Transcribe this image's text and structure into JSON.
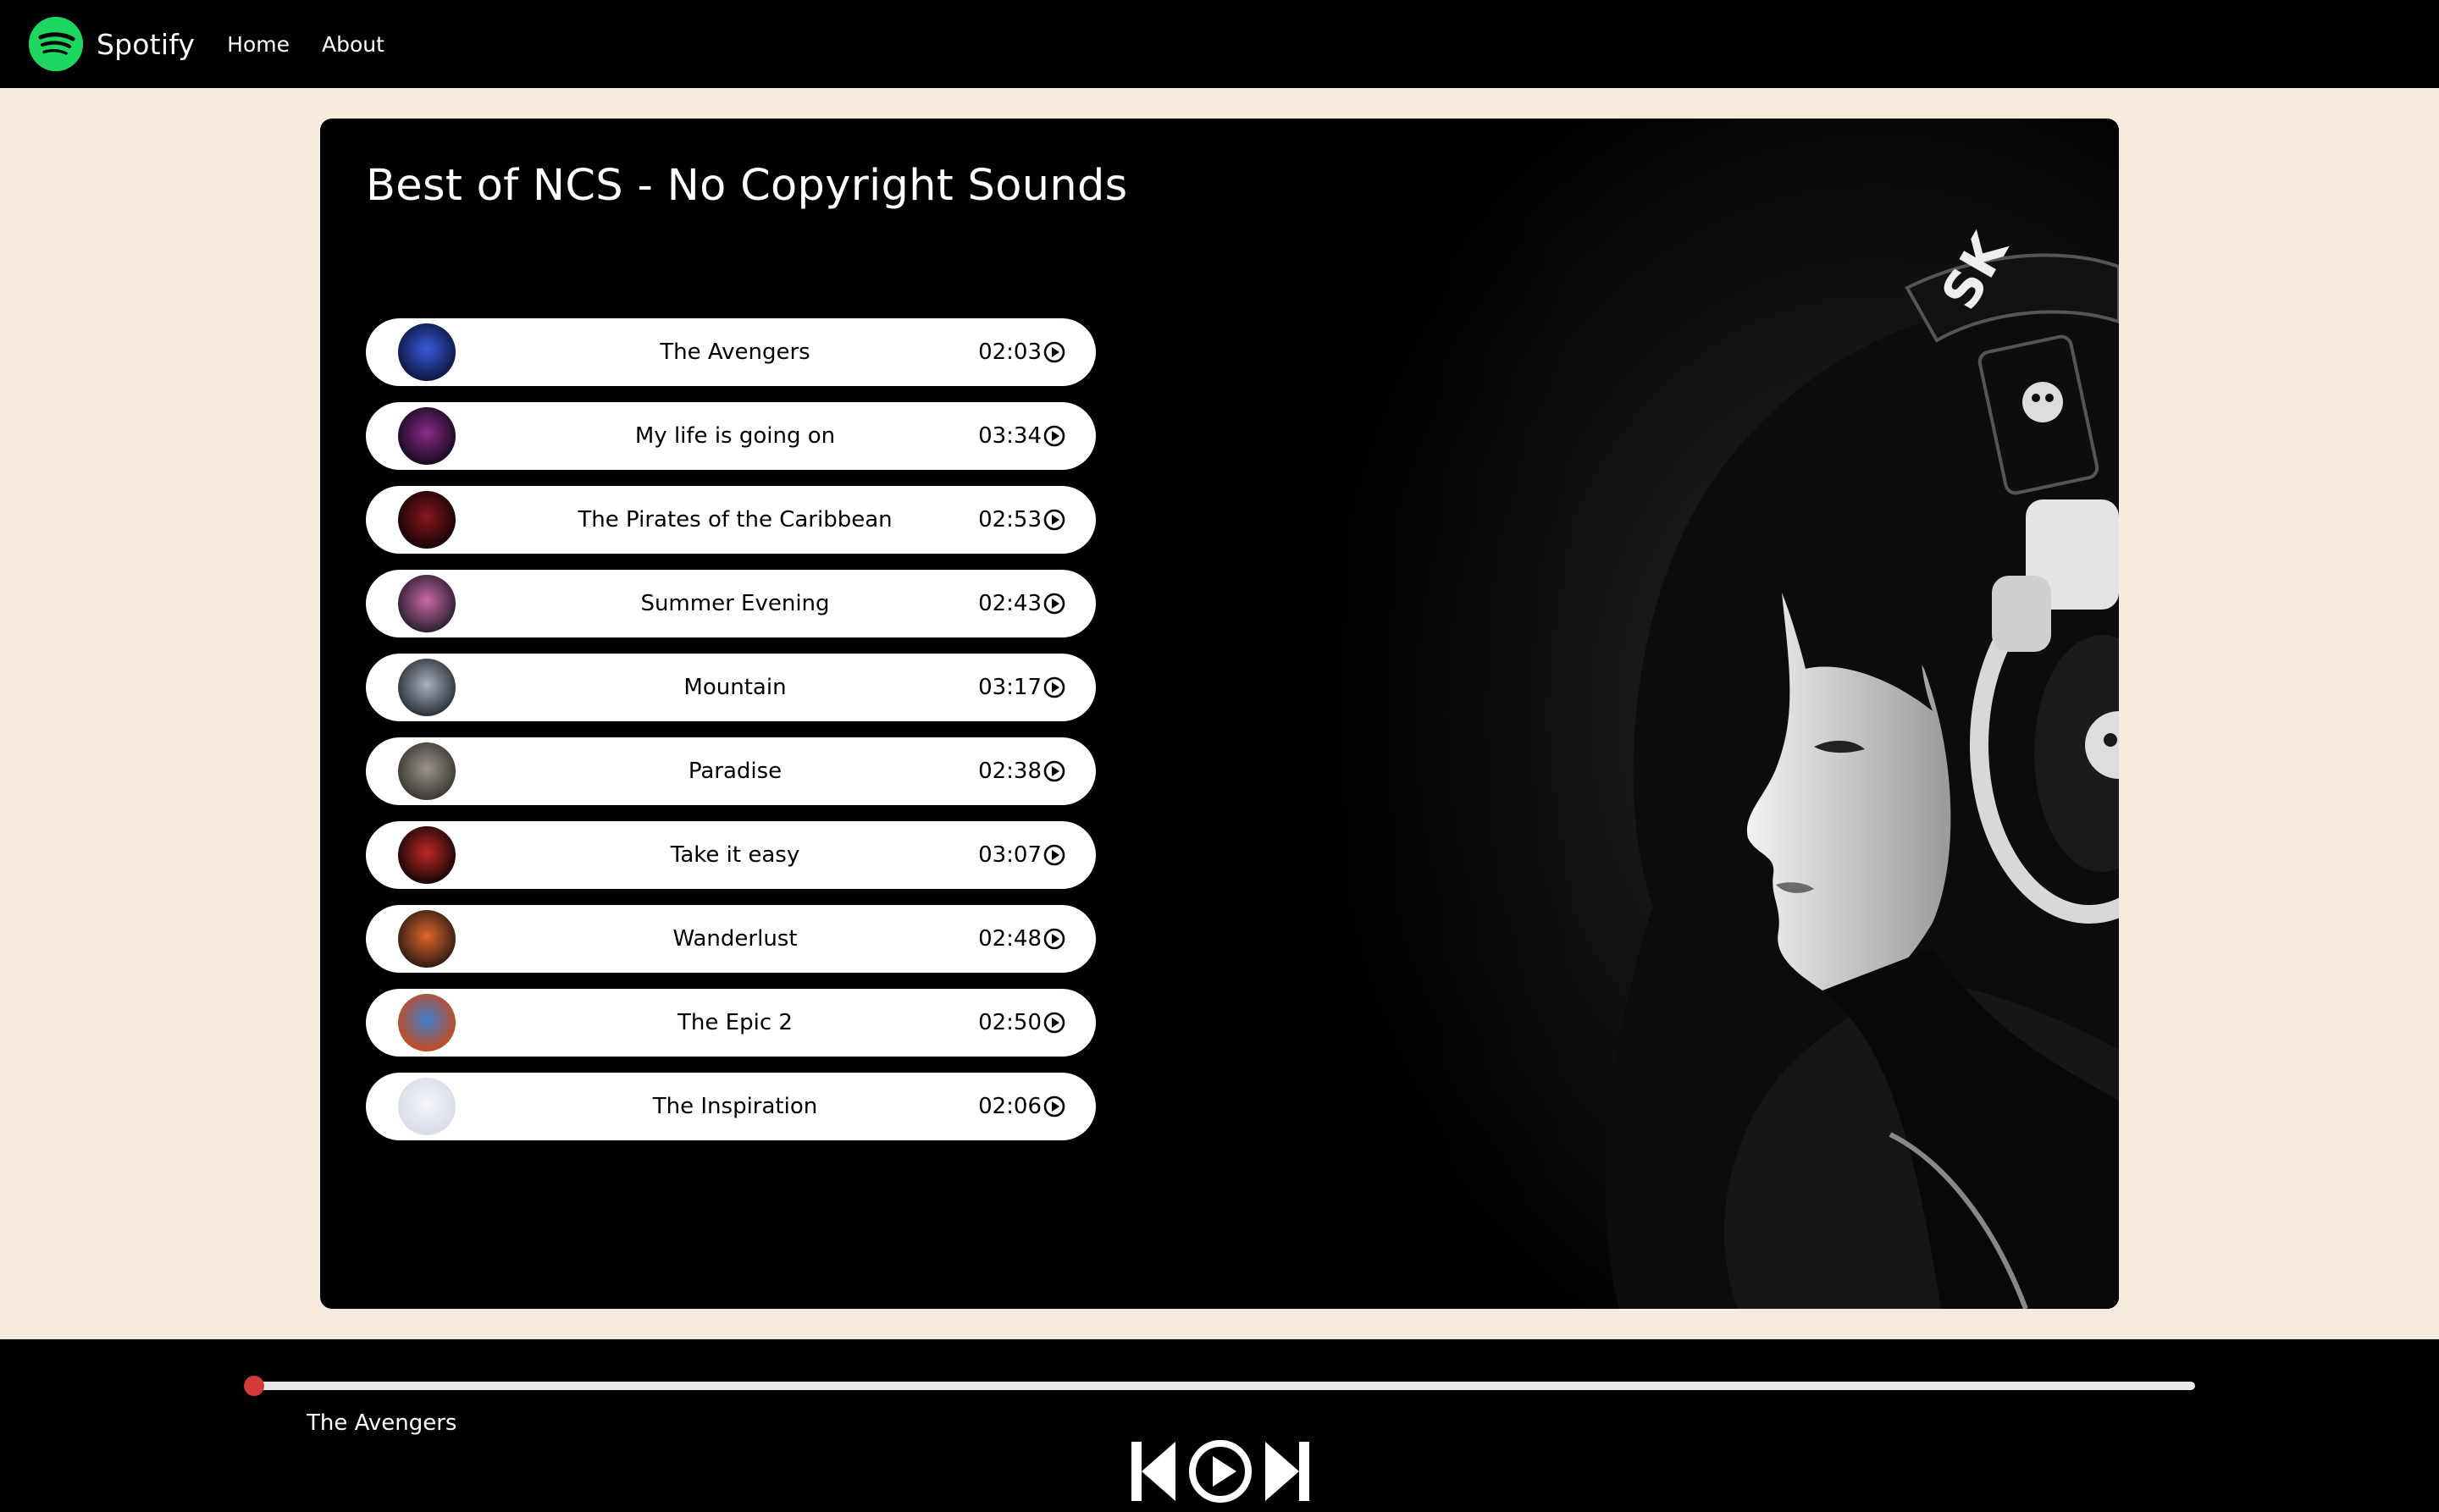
{
  "navbar": {
    "brand": "Spotify",
    "links": [
      "Home",
      "About"
    ],
    "logo_icon": "spotify-logo-icon",
    "logo_color": "#1ed760"
  },
  "playlist": {
    "title": "Best of NCS - No Copyright Sounds"
  },
  "songs": [
    {
      "name": "The Avengers",
      "time": "02:03",
      "cover": [
        "#0b1640",
        "#3a5bd8"
      ]
    },
    {
      "name": "My life is going on",
      "time": "03:34",
      "cover": [
        "#150a1e",
        "#8b2a8a"
      ]
    },
    {
      "name": "The Pirates of the Caribbean",
      "time": "02:53",
      "cover": [
        "#120405",
        "#8c1420"
      ]
    },
    {
      "name": "Summer Evening",
      "time": "02:43",
      "cover": [
        "#2a1e2e",
        "#c86aa8"
      ]
    },
    {
      "name": "Mountain",
      "time": "03:17",
      "cover": [
        "#2a3038",
        "#a8b0ba"
      ]
    },
    {
      "name": "Paradise",
      "time": "02:38",
      "cover": [
        "#3a3632",
        "#9a948a"
      ]
    },
    {
      "name": "Take it easy",
      "time": "03:07",
      "cover": [
        "#160606",
        "#c0282a"
      ]
    },
    {
      "name": "Wanderlust",
      "time": "02:48",
      "cover": [
        "#2e1c14",
        "#e0642a"
      ]
    },
    {
      "name": "The Epic 2",
      "time": "02:50",
      "cover": [
        "#c84a1c",
        "#3a7fd0"
      ]
    },
    {
      "name": "The Inspiration",
      "time": "02:06",
      "cover": [
        "#d8dce8",
        "#f4f4f8"
      ]
    }
  ],
  "player": {
    "current_song": "The Avengers",
    "progress": 0,
    "accent": "#d33a3a",
    "controls": [
      "previous-icon",
      "play-circle-icon",
      "next-icon"
    ]
  },
  "colors": {
    "page_bg": "#f6ebdd",
    "navbar_bg": "#000000",
    "card_bg": "#000000"
  },
  "hero_image": "woman-with-headphones-photo"
}
